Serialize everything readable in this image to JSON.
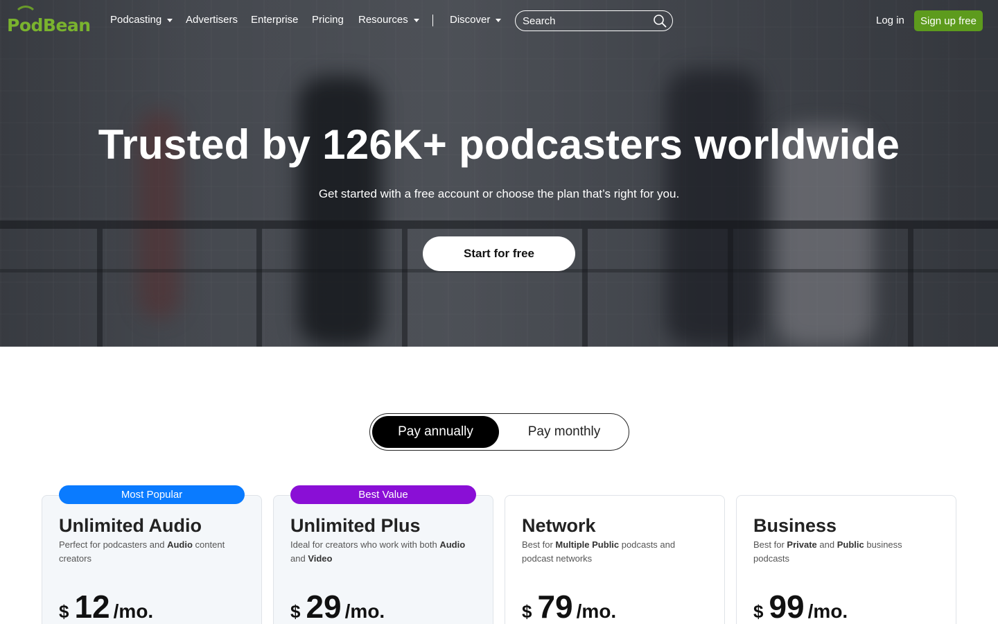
{
  "brand": {
    "logo_text": "PodBean",
    "accent": "#5d9b1d"
  },
  "nav": {
    "items": [
      {
        "label": "Podcasting",
        "dropdown": true
      },
      {
        "label": "Advertisers",
        "dropdown": false
      },
      {
        "label": "Enterprise",
        "dropdown": false
      },
      {
        "label": "Pricing",
        "dropdown": false
      },
      {
        "label": "Resources",
        "dropdown": true
      },
      {
        "label": "Discover",
        "dropdown": true
      }
    ],
    "search_placeholder": "Search",
    "login": "Log in",
    "signup": "Sign up free"
  },
  "hero": {
    "title": "Trusted by 126K+ podcasters worldwide",
    "subtitle": "Get started with a free account or choose the plan that’s right for you.",
    "cta": "Start for free"
  },
  "billing_toggle": {
    "options": [
      "Pay annually",
      "Pay monthly"
    ],
    "selected": "Pay annually"
  },
  "plans": [
    {
      "badge": "Most Popular",
      "badge_color": "#0a7bff",
      "name": "Unlimited Audio",
      "desc_parts": [
        "Perfect for podcasters and ",
        "Audio",
        " content creators"
      ],
      "currency": "$",
      "price": "12",
      "period": "/mo."
    },
    {
      "badge": "Best Value",
      "badge_color": "#8a0fd6",
      "name": "Unlimited Plus",
      "desc_parts": [
        "Ideal for creators who work with both ",
        "Audio",
        " and ",
        "Video"
      ],
      "currency": "$",
      "price": "29",
      "period": "/mo."
    },
    {
      "name": "Network",
      "desc_parts": [
        "Best for ",
        "Multiple Public",
        " podcasts and podcast networks"
      ],
      "currency": "$",
      "price": "79",
      "period": "/mo."
    },
    {
      "name": "Business",
      "desc_parts": [
        "Best for ",
        "Private",
        " and ",
        "Public",
        " business podcasts"
      ],
      "currency": "$",
      "price": "99",
      "period": "/mo."
    }
  ]
}
